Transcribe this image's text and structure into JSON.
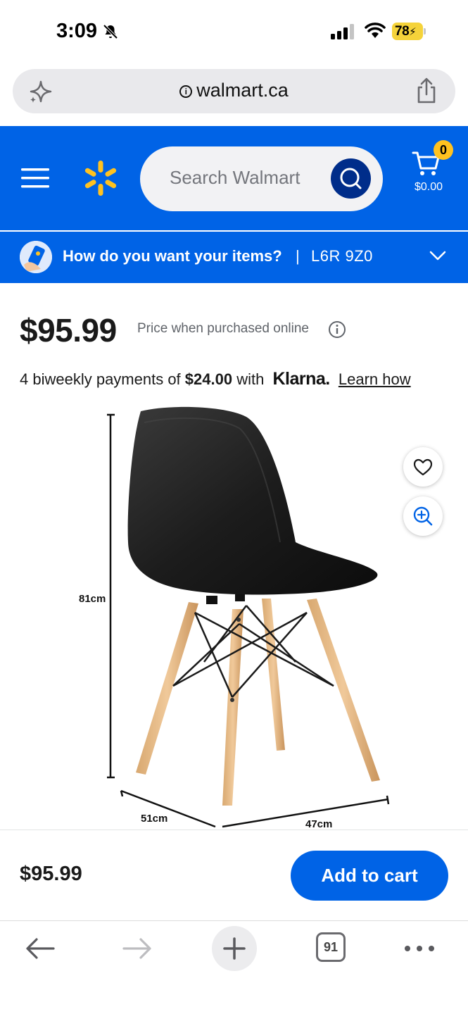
{
  "status_bar": {
    "time": "3:09",
    "battery": "78"
  },
  "browser": {
    "url": "walmart.ca",
    "tab_count": "91"
  },
  "header": {
    "search_placeholder": "Search Walmart",
    "cart_count": "0",
    "cart_total": "$0.00",
    "brand_color": "#0063e6",
    "accent_color": "#ffc220"
  },
  "delivery": {
    "prompt": "How do you want your items?",
    "separator": "|",
    "postal_code": "L6R 9Z0"
  },
  "product": {
    "price": "$95.99",
    "price_note": "Price when purchased online",
    "installments": {
      "prefix": "4 biweekly payments of",
      "amount": "$24.00",
      "with": "with",
      "provider": "Klarna.",
      "link": "Learn how"
    },
    "dimensions": {
      "height": "81cm",
      "depth": "51cm",
      "width": "47cm"
    }
  },
  "sticky_bar": {
    "price": "$95.99",
    "add_to_cart": "Add to cart"
  }
}
